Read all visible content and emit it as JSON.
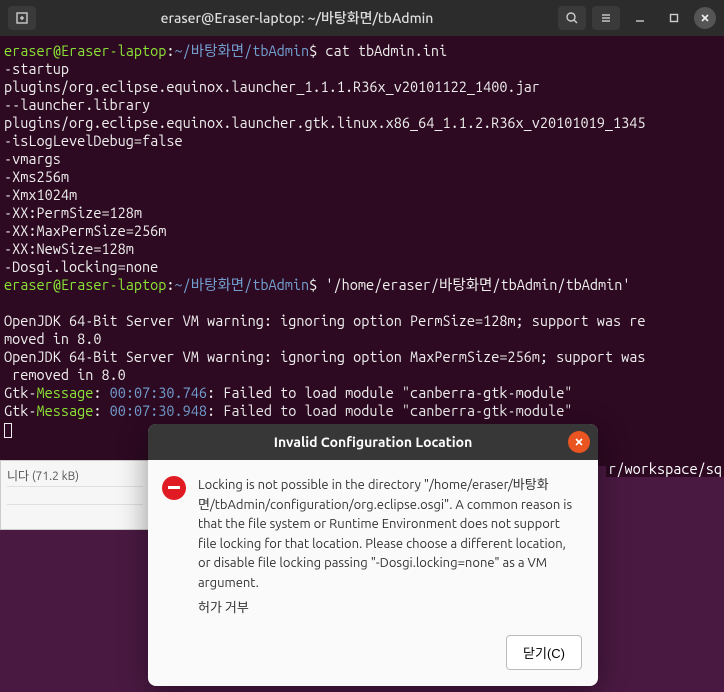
{
  "titlebar": {
    "title": "eraser@Eraser-laptop: ~/바탕화면/tbAdmin"
  },
  "prompt": {
    "user_host": "eraser@Eraser-laptop",
    "colon": ":",
    "path_prefix": "~/바탕화면",
    "path_suffix": "/tbAdmin",
    "dollar": "$"
  },
  "cmd1": "cat tbAdmin.ini",
  "out": {
    "l1": "-startup",
    "l2": "plugins/org.eclipse.equinox.launcher_1.1.1.R36x_v20101122_1400.jar",
    "l3": "--launcher.library",
    "l4": "plugins/org.eclipse.equinox.launcher.gtk.linux.x86_64_1.1.2.R36x_v20101019_1345",
    "l5": "-isLogLevelDebug=false",
    "l6": "-vmargs",
    "l7": "-Xms256m",
    "l8": "-Xmx1024m",
    "l9": "-XX:PermSize=128m",
    "l10": "-XX:MaxPermSize=256m",
    "l11": "-XX:NewSize=128m",
    "l12": "-Dosgi.locking=none"
  },
  "cmd2": "'/home/eraser/바탕화면/tbAdmin/tbAdmin'",
  "warn": {
    "w1a": "OpenJDK 64-Bit Server VM warning: ignoring option PermSize=128m; support was re",
    "w1b": "moved in 8.0",
    "w2a": "OpenJDK 64-Bit Server VM warning: ignoring option MaxPermSize=256m; support was",
    "w2b": " removed in 8.0"
  },
  "gtk": {
    "prefix": "Gtk-",
    "message": "Message",
    "colon": ": ",
    "time1": "00:07:30.746",
    "time2": "00:07:30.948",
    "tail": ": Failed to load module \"canberra-gtk-module\""
  },
  "filestrip": {
    "line": "니다 (71.2 kB)"
  },
  "workspace": "r/workspace/sq",
  "dialog": {
    "title": "Invalid Configuration Location",
    "body": "Locking is not possible in the directory \"/home/eraser/바탕화면/tbAdmin/configuration/org.eclipse.osgi\". A common reason is that the file system or Runtime Environment does not support file locking for that location. Please choose a different location, or disable file locking passing \"-Dosgi.locking=none\" as a VM argument.",
    "denied": "허가 거부",
    "close_btn": "닫기(C)"
  }
}
